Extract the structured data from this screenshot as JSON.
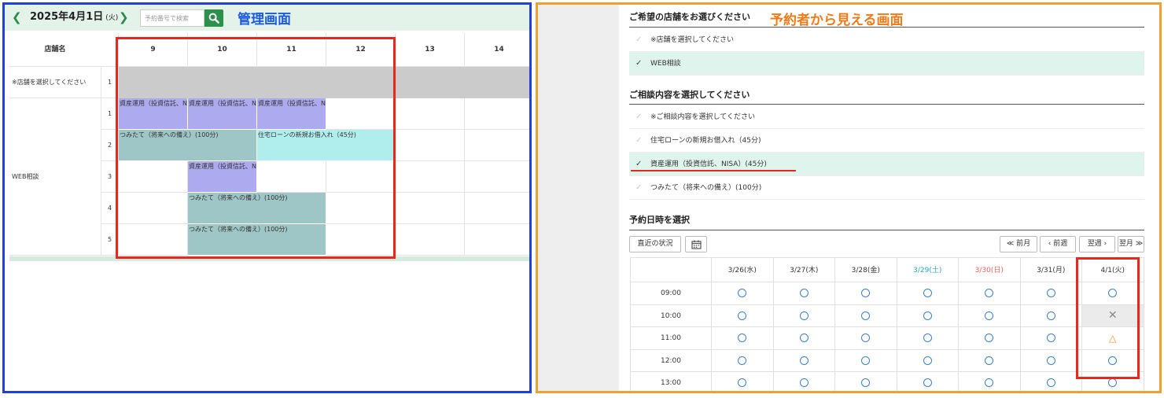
{
  "admin": {
    "title": "管理画面",
    "prev_icon": "chevron-left-icon",
    "next_icon": "chevron-right-icon",
    "date": "2025年4月1日",
    "weekday": "(火)",
    "search_placeholder": "予約番号で検索",
    "search_icon": "search-icon",
    "store_header": "店舗名",
    "hours": [
      "9",
      "10",
      "11",
      "12",
      "13",
      "14"
    ],
    "stores": [
      {
        "name": "※店舗を選択してください",
        "rows": [
          "1"
        ]
      },
      {
        "name": "WEB相談",
        "rows": [
          "1",
          "2",
          "3",
          "4",
          "5"
        ]
      }
    ],
    "events": [
      {
        "label": "資産運用（投資信託、NISA）",
        "row": 1,
        "col": 0,
        "span": 1,
        "color": "purple"
      },
      {
        "label": "資産運用（投資信託、NISA）",
        "row": 1,
        "col": 1,
        "span": 1,
        "color": "purple"
      },
      {
        "label": "資産運用（投資信託、NISA）",
        "row": 1,
        "col": 2,
        "span": 1,
        "color": "purple"
      },
      {
        "label": "つみたて（将来への備え）(100分)",
        "row": 2,
        "col": 0,
        "span": 2,
        "color": "teal"
      },
      {
        "label": "住宅ローンの新規お借入れ（45分)",
        "row": 2,
        "col": 2,
        "span": 2,
        "color": "cyan"
      },
      {
        "label": "資産運用（投資信託、NISA）",
        "row": 3,
        "col": 1,
        "span": 1,
        "color": "purple"
      },
      {
        "label": "つみたて（将来への備え）(100分)",
        "row": 4,
        "col": 1,
        "span": 2,
        "color": "teal"
      },
      {
        "label": "つみたて（将来への備え）(100分)",
        "row": 5,
        "col": 1,
        "span": 2,
        "color": "teal"
      }
    ]
  },
  "customer": {
    "title": "予約者から見える画面",
    "store_section": {
      "title": "ご希望の店舗をお選びください",
      "options": [
        {
          "label": "※店舗を選択してください",
          "selected": false
        },
        {
          "label": "WEB相談",
          "selected": true
        }
      ]
    },
    "consult_section": {
      "title": "ご相談内容を選択してください",
      "options": [
        {
          "label": "※ご相談内容を選択してください",
          "selected": false
        },
        {
          "label": "住宅ローンの新規お借入れ（45分)",
          "selected": false
        },
        {
          "label": "資産運用（投資信託、NISA）(45分)",
          "selected": true
        },
        {
          "label": "つみたて（将来への備え）(100分)",
          "selected": false
        }
      ]
    },
    "check_icon": "check-icon",
    "datetime_section": {
      "title": "予約日時を選択",
      "recent_label": "直近の状況",
      "calendar_icon": "calendar-icon",
      "prev_month": "≪ 前月",
      "prev_week": "‹ 前週",
      "next_week": "翌週 ›",
      "next_month": "翌月 ≫"
    },
    "schedule": {
      "dates": [
        {
          "label": "3/26(水)",
          "kind": "weekday"
        },
        {
          "label": "3/27(木)",
          "kind": "weekday"
        },
        {
          "label": "3/28(金)",
          "kind": "weekday"
        },
        {
          "label": "3/29(土)",
          "kind": "sat"
        },
        {
          "label": "3/30(日)",
          "kind": "sun"
        },
        {
          "label": "3/31(月)",
          "kind": "weekday"
        },
        {
          "label": "4/1(火)",
          "kind": "weekday"
        }
      ],
      "times": [
        "09:00",
        "10:00",
        "11:00",
        "12:00",
        "13:00"
      ],
      "availability": [
        [
          "o",
          "o",
          "o",
          "o",
          "o",
          "o",
          "o"
        ],
        [
          "o",
          "o",
          "o",
          "o",
          "o",
          "o",
          "x"
        ],
        [
          "o",
          "o",
          "o",
          "o",
          "o",
          "o",
          "t"
        ],
        [
          "o",
          "o",
          "o",
          "o",
          "o",
          "o",
          "o"
        ],
        [
          "o",
          "o",
          "o",
          "o",
          "o",
          "o",
          "o"
        ]
      ],
      "symbols": {
        "o": "○",
        "x": "✕",
        "t": "△"
      },
      "colors": {
        "available": "#3b7fc8",
        "full": "#888888",
        "few": "#e89020"
      }
    }
  }
}
